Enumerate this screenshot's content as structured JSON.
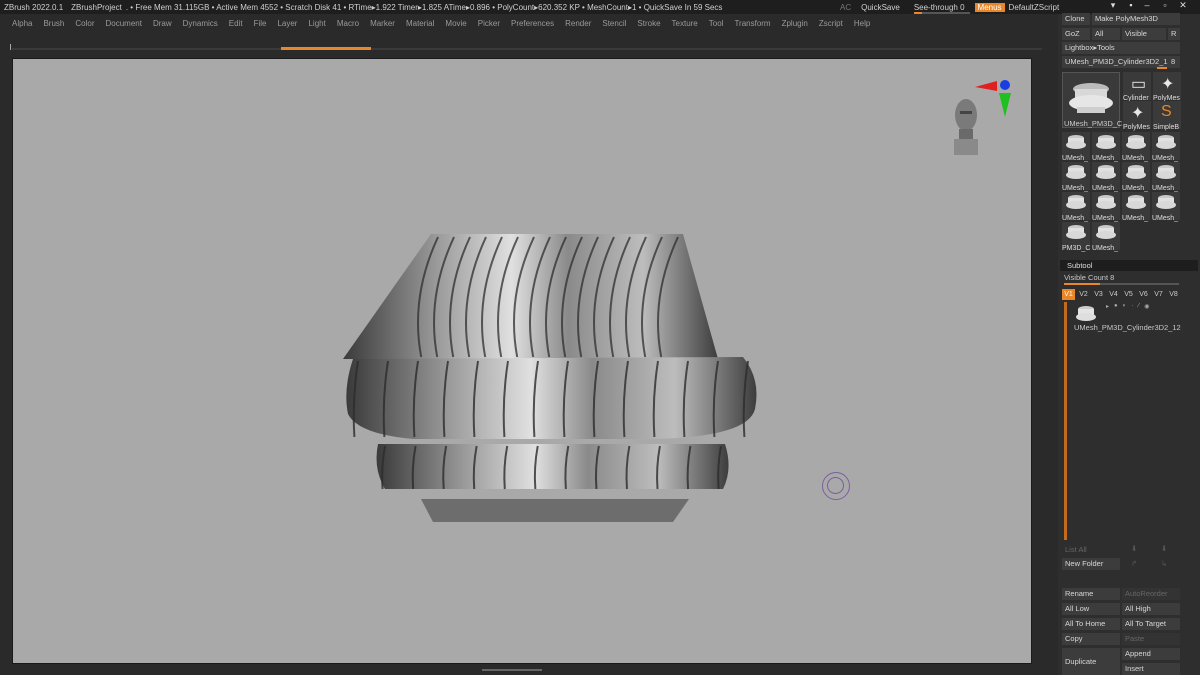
{
  "titlebar": {
    "app": "ZBrush 2022.0.1",
    "project": "ZBrushProject",
    "stats": ". • Free Mem 31.115GB • Active Mem 4552 • Scratch Disk 41 • RTime▸1.922 Timer▸1.825 ATime▸0.896 • PolyCount▸620.352 KP • MeshCount▸1 • QuickSave In 59 Secs",
    "ac": "AC",
    "quicksave": "QuickSave",
    "seethrough": "See-through",
    "seethrough_value": "0",
    "seethrough_level": 0.0,
    "menus": "Menus",
    "script": "DefaultZScript"
  },
  "menubar": [
    "Alpha",
    "Brush",
    "Color",
    "Document",
    "Draw",
    "Dynamics",
    "Edit",
    "File",
    "Layer",
    "Light",
    "Macro",
    "Marker",
    "Material",
    "Movie",
    "Picker",
    "Preferences",
    "Render",
    "Stencil",
    "Stroke",
    "Texture",
    "Tool",
    "Transform",
    "Zplugin",
    "Zscript",
    "Help"
  ],
  "tool_panel": {
    "clone": "Clone",
    "make_polymesh": "Make PolyMesh3D",
    "goz": "GoZ",
    "all": "All",
    "visible": "Visible",
    "r": "R",
    "lightbox": "Lightbox▸Tools",
    "current_tool": "UMesh_PM3D_Cylinder3D2_1",
    "current_tool_value": "8",
    "main_thumb_label": "UMesh_PM3D_C",
    "thumbs_top": [
      "Cylinder",
      "PolyMes",
      "PolyMes",
      "SimpleB"
    ],
    "thumbs_grid": [
      "UMesh_",
      "UMesh_",
      "UMesh_",
      "UMesh_",
      "UMesh_",
      "UMesh_",
      "UMesh_",
      "UMesh_",
      "UMesh_",
      "UMesh_",
      "UMesh_",
      "UMesh_",
      "PM3D_C",
      "UMesh_"
    ]
  },
  "subtool": {
    "title": "Subtool",
    "visible_count": "Visible Count 8",
    "tabs": [
      "V1",
      "V2",
      "V3",
      "V4",
      "V5",
      "V6",
      "V7",
      "V8"
    ],
    "item_name": "UMesh_PM3D_Cylinder3D2_12",
    "list_all": "List All",
    "new_folder": "New Folder",
    "rename": "Rename",
    "autoreorder": "AutoReorder",
    "all_low": "All Low",
    "all_high": "All High",
    "all_to_home": "All To Home",
    "all_to_target": "All To Target",
    "copy": "Copy",
    "paste": "Paste",
    "duplicate": "Duplicate",
    "append": "Append",
    "insert": "Insert"
  },
  "colors": {
    "accent": "#e8862a",
    "viewport": "#a9a9a9",
    "panel": "#2e2e2e"
  },
  "icons": [
    "minimize-icon",
    "restore-icon",
    "close-icon",
    "head-orientation-icon",
    "axis-gizmo-icon",
    "brush-cursor-icon"
  ]
}
